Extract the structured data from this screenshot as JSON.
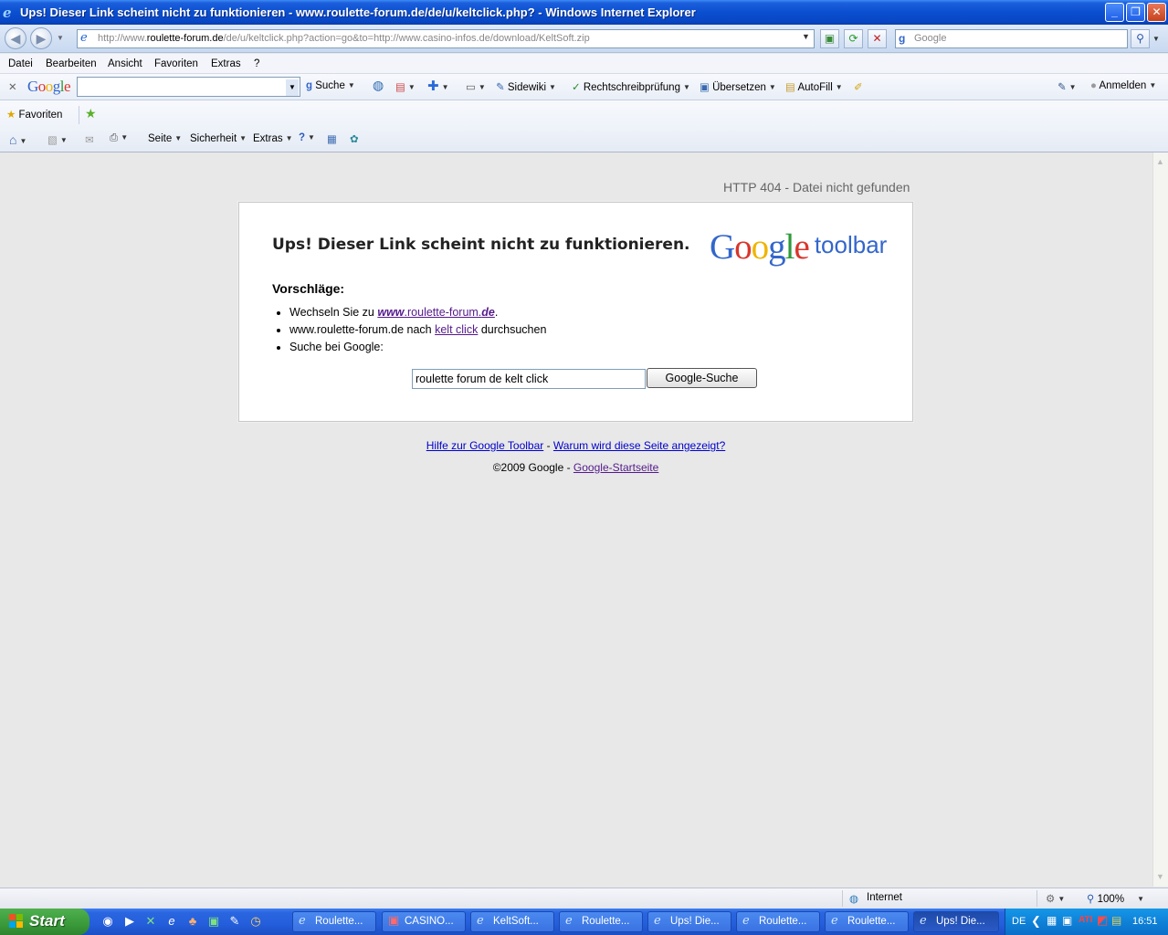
{
  "window": {
    "title": "Ups! Dieser Link scheint nicht zu funktionieren - www.roulette-forum.de/de/u/keltclick.php? - Windows Internet Explorer",
    "min": "_",
    "max": "❐",
    "close": "✕"
  },
  "address_bar": {
    "url_prefix": "http://www.",
    "url_domain": "roulette-forum.de",
    "url_rest": "/de/u/keltclick.php?action=go&to=http://www.casino-infos.de/download/KeltSoft.zip",
    "search_placeholder": "Google"
  },
  "menu": [
    "Datei",
    "Bearbeiten",
    "Ansicht",
    "Favoriten",
    "Extras",
    "?"
  ],
  "google_toolbar": {
    "logo": "Google",
    "search": "Suche",
    "sidewiki": "Sidewiki",
    "spellcheck": "Rechtschreibprüfung",
    "translate": "Übersetzen",
    "autofill": "AutoFill",
    "signin": "Anmelden"
  },
  "favorites_bar": {
    "favorites": "Favoriten"
  },
  "command_bar": {
    "page": "Seite",
    "security": "Sicherheit",
    "tools": "Extras"
  },
  "page": {
    "http_status": "HTTP 404 - Datei nicht gefunden",
    "heading": "Ups! Dieser Link scheint nicht zu funktionieren.",
    "logo_google": "Google",
    "logo_toolbar": "toolbar",
    "suggestions_title": "Vorschläge:",
    "s1_prefix": "Wechseln Sie zu ",
    "s1_link": "www.roulette-forum.de",
    "s1_suffix": ".",
    "s2_prefix": "www.roulette-forum.de nach ",
    "s2_link": "kelt click",
    "s2_suffix": " durchsuchen",
    "s3": "Suche bei Google:",
    "search_value": "roulette forum de kelt click",
    "search_button": "Google-Suche",
    "help_link": "Hilfe zur Google Toolbar",
    "separator": " - ",
    "why_link": "Warum wird diese Seite angezeigt?",
    "copyright": "©2009 Google - ",
    "home_link": "Google-Startseite"
  },
  "status_bar": {
    "zone": "Internet",
    "zoom": "100%"
  },
  "taskbar": {
    "start": "Start",
    "tasks": [
      "Roulette...",
      "CASINO...",
      "KeltSoft...",
      "Roulette...",
      "Ups! Die...",
      "Roulette...",
      "Roulette...",
      "Ups! Die..."
    ],
    "lang": "DE",
    "clock": "16:51"
  },
  "colors": {
    "titlebar": "#0a4fd0",
    "taskbar": "#245edb",
    "start": "#3a9a3a",
    "link_visited": "#551a8b",
    "link": "#0000cc"
  }
}
